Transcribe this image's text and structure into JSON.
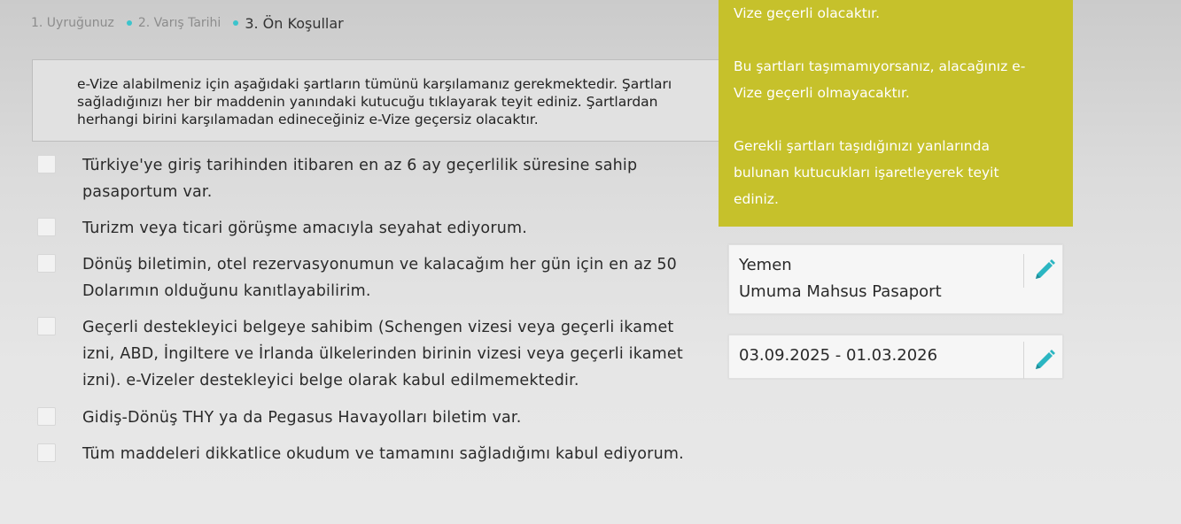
{
  "breadcrumb": {
    "steps": [
      "1. Uyruğunuz",
      "2. Varış Tarihi",
      "3. Ön Koşullar"
    ]
  },
  "notice": {
    "text": "e-Vize alabilmeniz için aşağıdaki şartların tümünü karşılamanız gerekmektedir. Şartları sağladığınızı her bir maddenin yanındaki kutucuğu tıklayarak teyit ediniz. Şartlardan herhangi birini karşılamadan edineceğiniz e-Vize geçersiz olacaktır."
  },
  "conditions": [
    {
      "text": "Türkiye'ye giriş tarihinden itibaren en az 6 ay geçerlilik süresine sahip pasaportum var.",
      "checked": false
    },
    {
      "text": "Turizm veya ticari görüşme amacıyla seyahat ediyorum.",
      "checked": false
    },
    {
      "text": "Dönüş biletimin, otel rezervasyonumun ve kalacağım her gün için en az 50 Dolarımın olduğunu kanıtlayabilirim.",
      "checked": false
    },
    {
      "text": "Geçerli destekleyici belgeye sahibim (Schengen vizesi veya geçerli ikamet izni, ABD, İngiltere ve İrlanda ülkelerinden birinin vizesi veya geçerli ikamet izni). e-Vizeler destekleyici belge olarak kabul edilmemektedir.",
      "checked": false
    },
    {
      "text": "Gidiş-Dönüş THY ya da Pegasus Havayolları biletim var.",
      "checked": false
    },
    {
      "text": "Tüm maddeleri dikkatlice okudum ve tamamını sağladığımı kabul ediyorum.",
      "checked": false
    }
  ],
  "info_panel": {
    "lines": [
      "Vize geçerli olacaktır.",
      "Bu şartları taşımamıyorsanız, alacağınız e-",
      "Vize geçerli olmayacaktır.",
      "Gerekli şartları taşıdığınızı yanlarında",
      "bulunan kutucukları işaretleyerek teyit",
      "ediniz."
    ]
  },
  "summary": {
    "country": "Yemen",
    "passport_type": "Umuma Mahsus Pasaport",
    "date_range": "03.09.2025 - 01.03.2026"
  },
  "colors": {
    "accent": "#3cc4cc",
    "panel": "#c6c12b",
    "edit_icon": "#2bb6c2"
  },
  "icons": {
    "edit": "pencil-icon"
  }
}
